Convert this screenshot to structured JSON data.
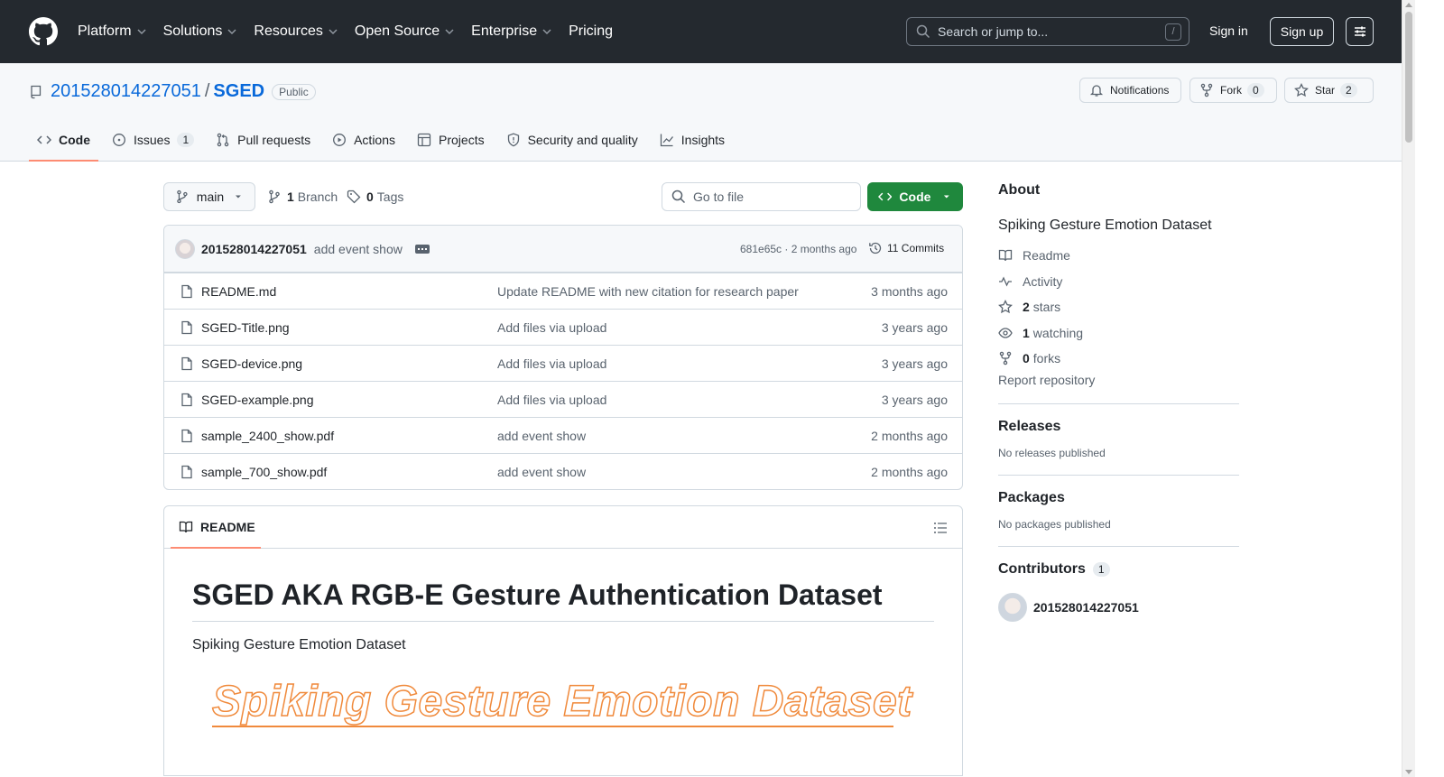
{
  "header": {
    "nav": [
      {
        "label": "Platform",
        "has_menu": true
      },
      {
        "label": "Solutions",
        "has_menu": true
      },
      {
        "label": "Resources",
        "has_menu": true
      },
      {
        "label": "Open Source",
        "has_menu": true
      },
      {
        "label": "Enterprise",
        "has_menu": true
      },
      {
        "label": "Pricing",
        "has_menu": false
      }
    ],
    "search_placeholder": "Search or jump to...",
    "search_shortcut": "/",
    "signin": "Sign in",
    "signup": "Sign up"
  },
  "repo": {
    "owner": "201528014227051",
    "separator": "/",
    "name": "SGED",
    "visibility": "Public",
    "notifications_label": "Notifications",
    "fork_label": "Fork",
    "fork_count": "0",
    "star_label": "Star",
    "star_count": "2"
  },
  "tabs": [
    {
      "label": "Code",
      "icon": "code-icon",
      "active": true
    },
    {
      "label": "Issues",
      "icon": "issue-icon",
      "count": "1"
    },
    {
      "label": "Pull requests",
      "icon": "pull-request-icon"
    },
    {
      "label": "Actions",
      "icon": "play-icon"
    },
    {
      "label": "Projects",
      "icon": "table-icon"
    },
    {
      "label": "Security and quality",
      "icon": "shield-icon"
    },
    {
      "label": "Insights",
      "icon": "graph-icon"
    }
  ],
  "toolbar": {
    "branch": "main",
    "branch_count": "1",
    "branch_label": "Branch",
    "tag_count": "0",
    "tag_label": "Tags",
    "goto_placeholder": "Go to file",
    "code_label": "Code"
  },
  "latest_commit": {
    "author": "201528014227051",
    "message": "add event show",
    "hash": "681e65c",
    "age": "2 months ago",
    "hash_age": "681e65c · 2 months ago",
    "commits_count": "11 Commits"
  },
  "files": [
    {
      "name": "README.md",
      "message": "Update README with new citation for research paper",
      "age": "3 months ago"
    },
    {
      "name": "SGED-Title.png",
      "message": "Add files via upload",
      "age": "3 years ago"
    },
    {
      "name": "SGED-device.png",
      "message": "Add files via upload",
      "age": "3 years ago"
    },
    {
      "name": "SGED-example.png",
      "message": "Add files via upload",
      "age": "3 years ago"
    },
    {
      "name": "sample_2400_show.pdf",
      "message": "add event show",
      "age": "2 months ago"
    },
    {
      "name": "sample_700_show.pdf",
      "message": "add event show",
      "age": "2 months ago"
    }
  ],
  "readme": {
    "tab_label": "README",
    "title": "SGED AKA RGB-E Gesture Authentication Dataset",
    "subtitle": "Spiking Gesture Emotion Dataset",
    "banner_text": "Spiking Gesture Emotion Dataset"
  },
  "sidebar": {
    "about_title": "About",
    "description": "Spiking Gesture Emotion Dataset",
    "links": [
      {
        "icon": "book-icon",
        "count": "",
        "label": "Readme"
      },
      {
        "icon": "pulse-icon",
        "count": "",
        "label": "Activity"
      },
      {
        "icon": "star-icon",
        "count": "2",
        "label": "stars"
      },
      {
        "icon": "eye-icon",
        "count": "1",
        "label": "watching"
      },
      {
        "icon": "fork-icon",
        "count": "0",
        "label": "forks"
      }
    ],
    "report": "Report repository",
    "releases_title": "Releases",
    "releases_note": "No releases published",
    "packages_title": "Packages",
    "packages_note": "No packages published",
    "contributors_title": "Contributors",
    "contributors_count": "1",
    "contributor_name": "201528014227051"
  },
  "colors": {
    "header_bg": "#24292f",
    "link": "#0969da",
    "primary_button": "#1f883d",
    "active_tab_underline": "#fd8c73",
    "banner_orange": "#f08a3c"
  }
}
